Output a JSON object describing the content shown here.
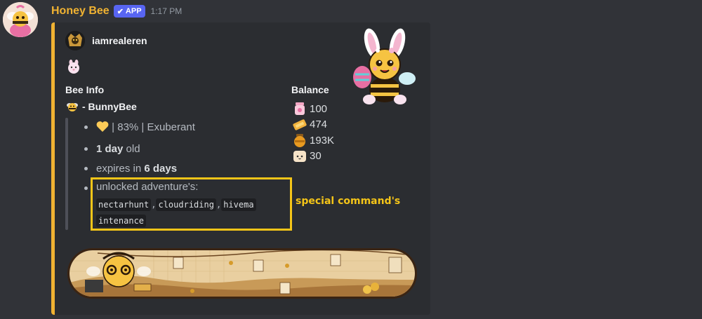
{
  "message": {
    "username": "Honey Bee",
    "badge": "APP",
    "badge_check": "✔",
    "timestamp": "1:17 PM"
  },
  "embed": {
    "accent_color": "#f0b232",
    "author": "iamrealeren",
    "bee_info": {
      "title": "Bee Info",
      "bee_name": "- BunnyBee",
      "mood_line": "| 83% | Exuberant",
      "age_value": "1 day",
      "age_suffix": "old",
      "expires_prefix": "expires in",
      "expires_value": "6 days",
      "unlocked_label": "unlocked adventure's:",
      "commands": [
        "nectarhunt",
        "cloudriding",
        "hivema",
        "intenance"
      ],
      "separator": ","
    },
    "balance": {
      "title": "Balance",
      "items": [
        {
          "icon": "jar-icon",
          "value": "100"
        },
        {
          "icon": "ticket-icon",
          "value": "474"
        },
        {
          "icon": "honey-pot-icon",
          "value": "193K"
        },
        {
          "icon": "cube-face-icon",
          "value": "30"
        }
      ]
    }
  },
  "annotation": {
    "text": "special command's",
    "color": "#f5c518"
  }
}
